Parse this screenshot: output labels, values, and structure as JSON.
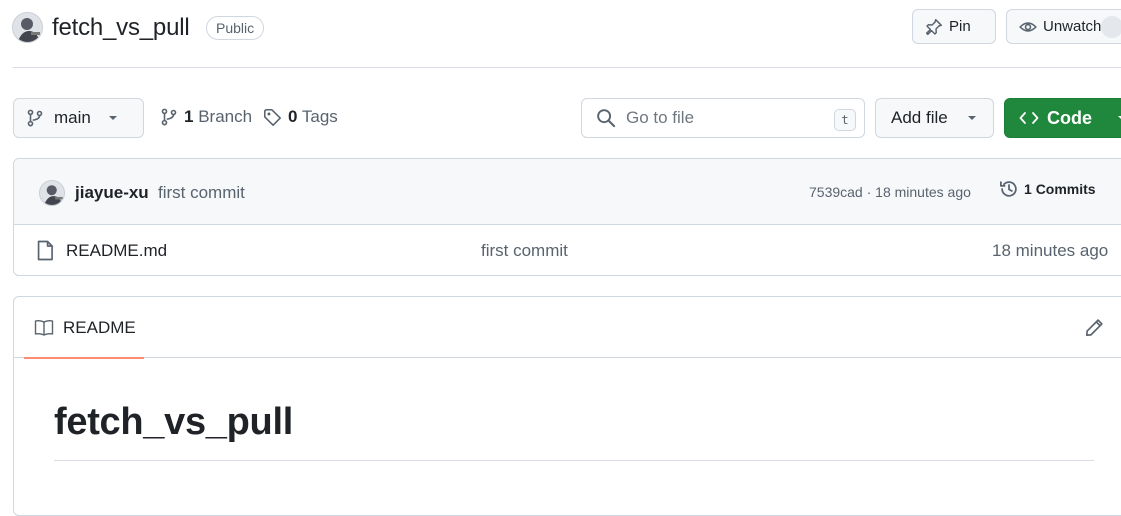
{
  "repo": {
    "name": "fetch_vs_pull",
    "visibility": "Public",
    "actions": {
      "pin_label": "Pin",
      "unwatch_label": "Unwatch"
    }
  },
  "toolbar": {
    "branch": "main",
    "branch_count": "1",
    "branch_label": "Branch",
    "tag_count": "0",
    "tag_label": "Tags",
    "search_placeholder": "Go to file",
    "search_shortcut": "t",
    "add_file_label": "Add file",
    "code_label": "Code"
  },
  "latest_commit": {
    "author": "jiayue-xu",
    "message": "first commit",
    "meta": "7539cad · 18 minutes ago",
    "commits_count": "1",
    "commits_label": "Commits"
  },
  "files": [
    {
      "name": "README.md",
      "commit": "first commit",
      "age": "18 minutes ago"
    }
  ],
  "readme": {
    "tab_label": "README",
    "heading": "fetch_vs_pull"
  },
  "colors": {
    "primary_green": "#1f883d",
    "tab_underline": "#fd8c73",
    "border": "#d0d7de",
    "muted_text": "#59636e"
  },
  "icons": [
    "avatar",
    "pin-icon",
    "eye-icon",
    "git-branch-icon",
    "tag-icon",
    "search-icon",
    "code-icon",
    "caret-down-icon",
    "history-icon",
    "file-icon",
    "book-icon",
    "pencil-icon"
  ]
}
